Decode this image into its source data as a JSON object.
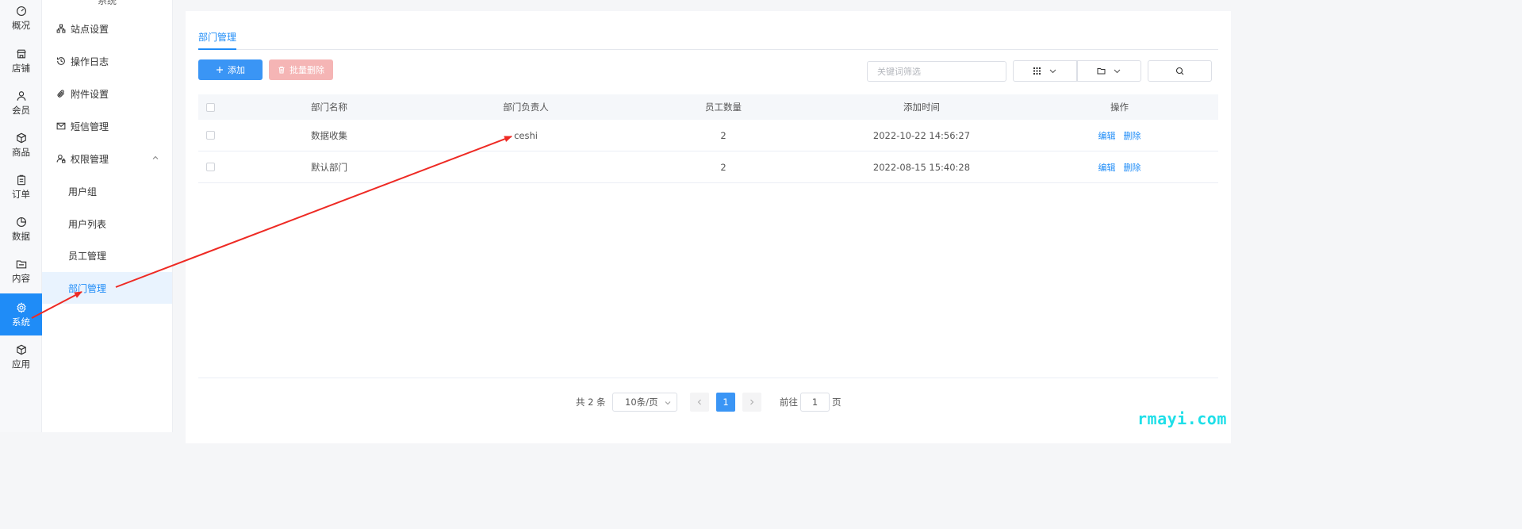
{
  "rail": {
    "items": [
      {
        "label": "概况",
        "icon": "gauge-icon"
      },
      {
        "label": "店铺",
        "icon": "store-icon"
      },
      {
        "label": "会员",
        "icon": "user-icon"
      },
      {
        "label": "商品",
        "icon": "box-icon"
      },
      {
        "label": "订单",
        "icon": "clipboard-icon"
      },
      {
        "label": "数据",
        "icon": "pie-chart-icon"
      },
      {
        "label": "内容",
        "icon": "folder-icon"
      },
      {
        "label": "系统",
        "icon": "gear-icon"
      },
      {
        "label": "应用",
        "icon": "cube-icon"
      }
    ],
    "active_color": "#1f8cf7"
  },
  "submenu": {
    "cut_title": "系统",
    "items": [
      {
        "label": "站点设置",
        "icon": "sitemap-icon"
      },
      {
        "label": "操作日志",
        "icon": "history-icon"
      },
      {
        "label": "附件设置",
        "icon": "paperclip-icon"
      },
      {
        "label": "短信管理",
        "icon": "mail-icon"
      },
      {
        "label": "权限管理",
        "icon": "user-lock-icon"
      }
    ],
    "children": [
      {
        "label": "用户组"
      },
      {
        "label": "用户列表"
      },
      {
        "label": "员工管理"
      },
      {
        "label": "部门管理"
      }
    ]
  },
  "tabs": [
    {
      "label": "部门管理"
    }
  ],
  "toolbar": {
    "add_label": "添加",
    "batch_delete_label": "批量删除",
    "keyword_placeholder": "关键词筛选"
  },
  "table": {
    "columns": [
      "部门名称",
      "部门负责人",
      "员工数量",
      "添加时间",
      "操作"
    ],
    "rows": [
      {
        "name": "数据收集",
        "leader": "ceshi",
        "count": "2",
        "time": "2022-10-22 14:56:27"
      },
      {
        "name": "默认部门",
        "leader": "",
        "count": "2",
        "time": "2022-08-15 15:40:28"
      }
    ],
    "action_edit": "编辑",
    "action_delete": "删除"
  },
  "pagination": {
    "total_text": "共 2 条",
    "page_size": "10条/页",
    "current_page": "1",
    "goto_prefix": "前往",
    "goto_value": "1",
    "goto_suffix": "页"
  },
  "watermark": "rmayi.com"
}
